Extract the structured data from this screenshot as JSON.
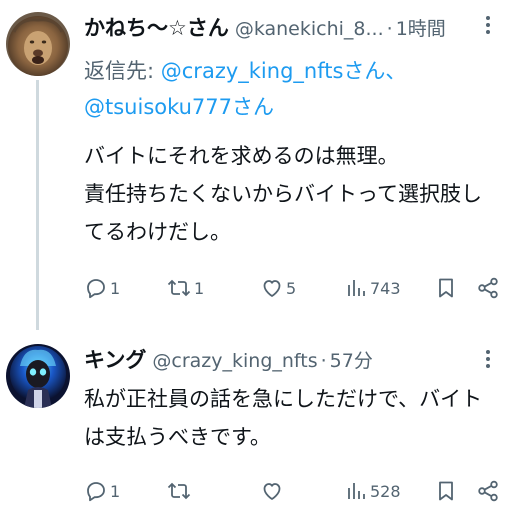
{
  "tweets": [
    {
      "display_name": "かねち〜☆さん",
      "handle": "@kanekichi_8...",
      "separator": "·",
      "time": "1時間",
      "reply_prefix": "返信先: ",
      "reply_mention_1": "@crazy_king_nftsさん、",
      "reply_mention_2": "@tsuisoku777さん",
      "text": "バイトにそれを求めるのは無理。\n責任持ちたくないからバイトって選択肢し\nてるわけだし。",
      "replies": "1",
      "retweets": "1",
      "likes": "5",
      "views": "743",
      "avatar_icon": "lion-avatar"
    },
    {
      "display_name": "キング",
      "handle": "@crazy_king_nfts",
      "separator": "·",
      "time": "57分",
      "text": "私が正社員の話を急にしただけで、バイト\nは支払うべきです。",
      "replies": "1",
      "retweets": "",
      "likes": "",
      "views": "528",
      "avatar_icon": "blue-skull-avatar"
    }
  ],
  "colors": {
    "text": "#0f1419",
    "secondary": "#536471",
    "link": "#1d9bf0",
    "thread_line": "#cfd9de"
  }
}
